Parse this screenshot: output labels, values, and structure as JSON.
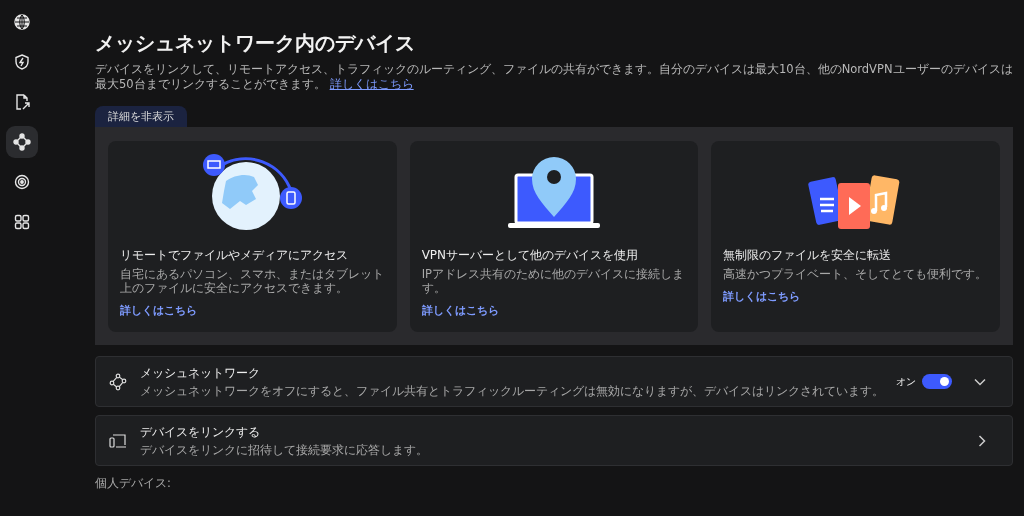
{
  "sidebar": {
    "items": [
      {
        "selected": false
      },
      {
        "selected": false
      },
      {
        "selected": false
      },
      {
        "selected": true
      },
      {
        "selected": false
      },
      {
        "selected": false
      }
    ]
  },
  "header": {
    "title": "メッシュネットワーク内のデバイス",
    "description": "デバイスをリンクして、リモートアクセス、トラフィックのルーティング、ファイルの共有ができます。自分のデバイスは最大10台、他のNordVPNユーザーのデバイスは最大50台までリンクすることができます。",
    "link": "詳しくはこちら"
  },
  "details_tab": {
    "label": "詳細を非表示",
    "expanded": true
  },
  "cards": [
    {
      "kind": "globe",
      "title": "リモートでファイルやメディアにアクセス",
      "text": "自宅にあるパソコン、スマホ、またはタブレット上のファイルに安全にアクセスできます。",
      "link": "詳しくはこちら"
    },
    {
      "kind": "laptop",
      "title": "VPNサーバーとして他のデバイスを使用",
      "text": "IPアドレス共有のために他のデバイスに接続します。",
      "link": "詳しくはこちら"
    },
    {
      "kind": "files",
      "title": "無制限のファイルを安全に転送",
      "text": "高速かつプライベート、そしてとても便利です。",
      "link": "詳しくはこちら"
    }
  ],
  "settings": [
    {
      "kind": "toggle",
      "title": "メッシュネットワーク",
      "text": "メッシュネットワークをオフにすると、ファイル共有とトラフィックルーティングは無効になりますが、デバイスはリンクされています。",
      "state_label": "オン",
      "on": true
    },
    {
      "kind": "link",
      "title": "デバイスをリンクする",
      "text": "デバイスをリンクに招待して接続要求に応答します。"
    }
  ],
  "section_label": "個人デバイス:"
}
